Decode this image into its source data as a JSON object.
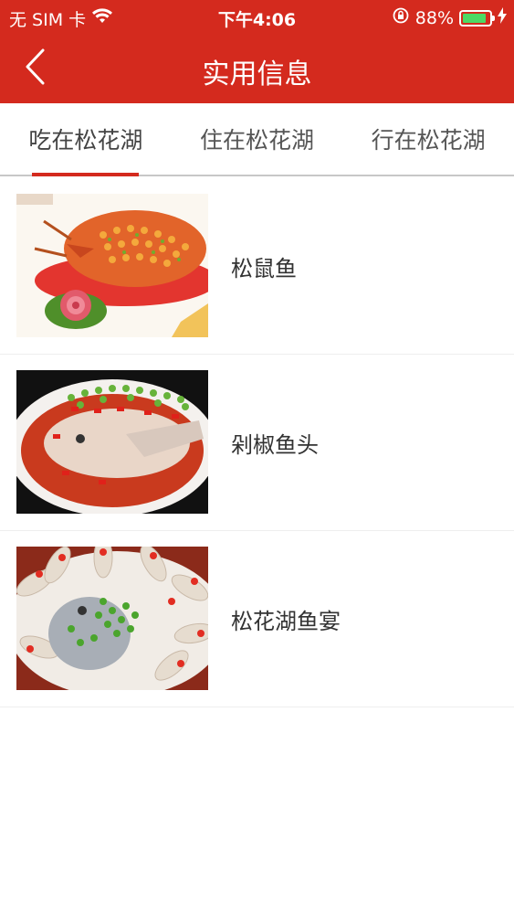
{
  "status_bar": {
    "carrier": "无 SIM 卡",
    "time": "下午4:06",
    "battery": "88%",
    "battery_level": 0.88,
    "wifi_icon": "wifi-icon",
    "lock_icon": "orientation-lock-icon",
    "charging_icon": "charging-bolt-icon"
  },
  "nav": {
    "title": "实用信息",
    "back_icon": "chevron-left-icon"
  },
  "tabs": [
    {
      "label": "吃在松花湖",
      "active": true
    },
    {
      "label": "住在松花湖",
      "active": false
    },
    {
      "label": "行在松花湖",
      "active": false
    }
  ],
  "items": [
    {
      "name": "松鼠鱼"
    },
    {
      "name": "剁椒鱼头"
    },
    {
      "name": "松花湖鱼宴"
    }
  ],
  "colors": {
    "brand_red": "#d42a1e",
    "battery_green": "#4cd964"
  }
}
